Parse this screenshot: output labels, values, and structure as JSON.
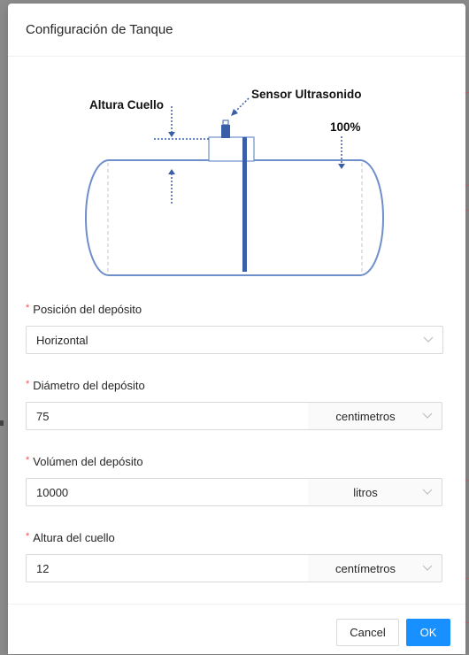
{
  "modal": {
    "title": "Configuración de Tanque"
  },
  "diagram": {
    "neck_height_label": "Altura Cuello",
    "sensor_label": "Sensor Ultrasonido",
    "full_label": "100%"
  },
  "fields": {
    "position": {
      "label": "Posición del depósito",
      "value": "Horizontal"
    },
    "diameter": {
      "label": "Diámetro del depósito",
      "value": "75",
      "unit": "centimetros"
    },
    "volume": {
      "label": "Volúmen del depósito",
      "value": "10000",
      "unit": "litros"
    },
    "neck": {
      "label": "Altura del cuello",
      "value": "12",
      "unit": "centímetros"
    }
  },
  "footer": {
    "cancel_label": "Cancel",
    "ok_label": "OK"
  },
  "colors": {
    "primary": "#1890ff",
    "required": "#ff4d4f",
    "tank_stroke": "#5a7fc0",
    "sensor": "#3a5ea8"
  }
}
